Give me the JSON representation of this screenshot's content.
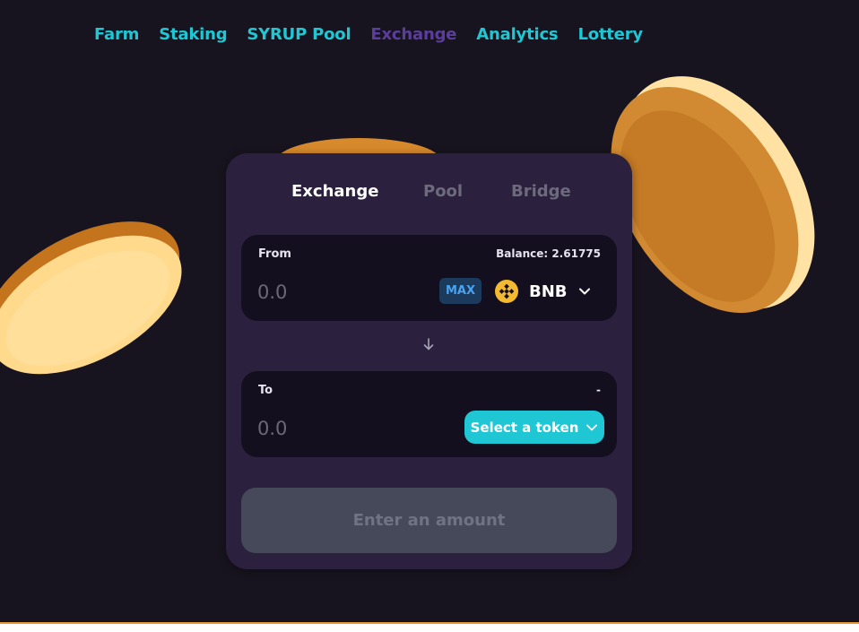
{
  "nav": {
    "items": [
      {
        "label": "Farm",
        "active": false
      },
      {
        "label": "Staking",
        "active": false
      },
      {
        "label": "SYRUP Pool",
        "active": false
      },
      {
        "label": "Exchange",
        "active": true
      },
      {
        "label": "Analytics",
        "active": false
      },
      {
        "label": "Lottery",
        "active": false
      }
    ]
  },
  "tabs": [
    {
      "label": "Exchange",
      "active": true
    },
    {
      "label": "Pool",
      "active": false
    },
    {
      "label": "Bridge",
      "active": false
    }
  ],
  "from": {
    "label": "From",
    "balance": "Balance: 2.61775",
    "placeholder": "0.0",
    "max_label": "MAX",
    "token_symbol": "BNB",
    "token_icon": "bnb-icon"
  },
  "to": {
    "label": "To",
    "balance": "-",
    "placeholder": "0.0",
    "select_label": "Select a token"
  },
  "action_button": "Enter an amount",
  "colors": {
    "background": "#18141f",
    "card": "#2b203d",
    "accent": "#1fc7d4",
    "active_nav": "#5b3d9c",
    "coin": "#f2a33a"
  }
}
